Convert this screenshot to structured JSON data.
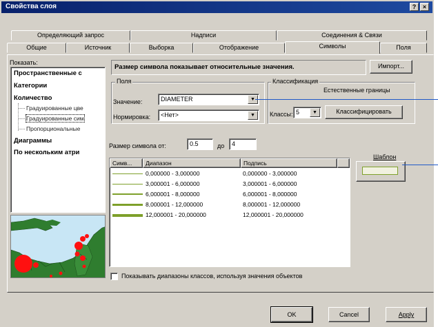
{
  "window": {
    "title": "Свойства слоя",
    "help_glyph": "?",
    "close_glyph": "×"
  },
  "tabs": {
    "top_row": [
      "Определяющий запрос",
      "Надписи",
      "Соединения & Связи"
    ],
    "bottom_row": [
      "Общие",
      "Источник",
      "Выборка",
      "Отображение",
      "Символы",
      "Поля"
    ],
    "active": "Символы"
  },
  "show": {
    "label": "Показать:",
    "items": [
      {
        "text": "Пространственные с",
        "bold": true
      },
      {
        "text": "Категории",
        "bold": true
      },
      {
        "text": "Количество",
        "bold": true
      },
      {
        "text": "Градуированные цве",
        "bold": false
      },
      {
        "text": "Градуированные сим",
        "bold": false,
        "selected": true
      },
      {
        "text": "Пропорциональные",
        "bold": false
      },
      {
        "text": "Диаграммы",
        "bold": true
      },
      {
        "text": "По нескольким атри",
        "bold": true
      }
    ]
  },
  "header": {
    "description": "Размер символа показывает относительные значения.",
    "import_button": "Импорт..."
  },
  "fields": {
    "group_label": "Поля",
    "value_label": "Значение:",
    "value": "DIAMETER",
    "normalization_label": "Нормировка:",
    "normalization_value": "<Нет>"
  },
  "classification": {
    "group_label": "Классификация",
    "method": "Естественные границы",
    "classes_label": "Классы:",
    "classes_value": "5",
    "classify_button": "Классифицировать"
  },
  "symbol_size": {
    "from_label": "Размер символа от:",
    "from_value": "0.5",
    "to_label": "до",
    "to_value": "4"
  },
  "template": {
    "label": "Шаблон"
  },
  "table": {
    "columns": [
      "Симв...",
      "Диапазон",
      "Подпись"
    ],
    "rows": [
      {
        "range": "0,000000 - 3,000000",
        "label": "0,000000 - 3,000000",
        "line_width": 0.5
      },
      {
        "range": "3,000001 - 6,000000",
        "label": "3,000001 - 6,000000",
        "line_width": 1.3
      },
      {
        "range": "6,000001 - 8,000000",
        "label": "6,000001 - 8,000000",
        "line_width": 2.1
      },
      {
        "range": "8,000001 - 12,000000",
        "label": "8,000001 - 12,000000",
        "line_width": 3
      },
      {
        "range": "12,000001 - 20,000000",
        "label": "12,000001 - 20,000000",
        "line_width": 4
      }
    ]
  },
  "checkbox": {
    "label": "Показывать диапазоны классов, используя значения объектов",
    "checked": false
  },
  "buttons": {
    "ok": "OK",
    "cancel": "Cancel",
    "apply": "Apply"
  },
  "colors": {
    "title_bar": "#08216b",
    "line_symbol": "#7ea02a",
    "map_land": "#2f7d2f",
    "map_water": "#c8e6f5",
    "map_point": "#ff1010"
  }
}
